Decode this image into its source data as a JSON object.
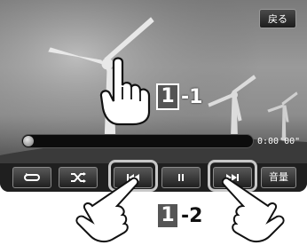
{
  "header": {
    "back_label": "戻る"
  },
  "playback": {
    "time": "0:00'00\"",
    "progress": 0
  },
  "controls": {
    "repeat_icon": "repeat-icon",
    "shuffle_icon": "shuffle-icon",
    "prev_icon": "skip-previous-icon",
    "pause_icon": "pause-icon",
    "next_icon": "skip-next-icon",
    "volume_label": "音量"
  },
  "callouts": {
    "c1": {
      "num": "1",
      "suffix": "-1"
    },
    "c2": {
      "num": "1",
      "suffix": "-2"
    }
  },
  "colors": {
    "button_border": "#8a8a8a",
    "highlight": "#c8c8c8"
  }
}
